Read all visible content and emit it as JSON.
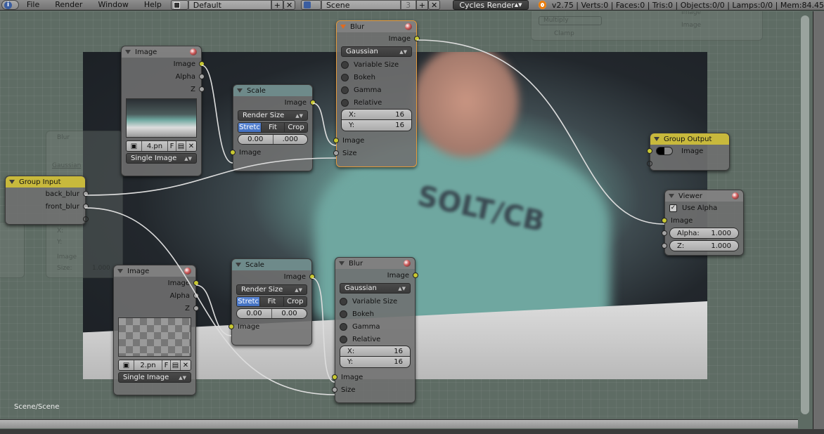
{
  "topbar": {
    "info_icon": "info-icon",
    "menus": [
      "File",
      "Render",
      "Window",
      "Help"
    ],
    "layout_name": "Default",
    "scene_name": "Scene",
    "scene_users": "3",
    "engine": "Cycles Render",
    "stats": "v2.75 | Verts:0 | Faces:0 | Tris:0 | Objects:0/0 | Lamps:0/0 | Mem:84.45"
  },
  "ghost": {
    "multiply": "Multiply",
    "clamp": "Clamp",
    "image1": "Image",
    "image2": "Image",
    "blur": "Blur",
    "gaussian": "Gaussian",
    "x": "X:",
    "y": "Y:",
    "image": "Image",
    "size": "Size:",
    "size_val": "1.000"
  },
  "nodes": {
    "image_top": {
      "title": "Image",
      "outputs": [
        "Image",
        "Alpha",
        "Z"
      ],
      "file": "4.pn",
      "fake_user": "F",
      "source": "Single Image"
    },
    "scale_top": {
      "title": "Scale",
      "output": "Image",
      "space": "Render Size",
      "modes": [
        "Stretc",
        "Fit",
        "Crop"
      ],
      "active_mode": "Stretc",
      "offset_x": "0.00",
      "offset_y": ".000",
      "input": "Image"
    },
    "blur_top": {
      "title": "Blur",
      "output": "Image",
      "filter": "Gaussian",
      "options": [
        "Variable Size",
        "Bokeh",
        "Gamma",
        "Relative"
      ],
      "x_label": "X:",
      "x_val": "16",
      "y_label": "Y:",
      "y_val": "16",
      "inputs": [
        "Image",
        "Size"
      ]
    },
    "group_input": {
      "title": "Group Input",
      "outputs": [
        "back_blur",
        "front_blur"
      ]
    },
    "group_output": {
      "title": "Group Output",
      "input": "Image"
    },
    "viewer": {
      "title": "Viewer",
      "use_alpha": "Use Alpha",
      "use_alpha_checked": true,
      "input": "Image",
      "alpha_label": "Alpha:",
      "alpha_val": "1.000",
      "z_label": "Z:",
      "z_val": "1.000"
    },
    "image_bottom": {
      "title": "Image",
      "outputs": [
        "Image",
        "Alpha",
        "Z"
      ],
      "file": "2.pn",
      "fake_user": "F",
      "source": "Single Image"
    },
    "scale_bottom": {
      "title": "Scale",
      "output": "Image",
      "space": "Render Size",
      "modes": [
        "Stretc",
        "Fit",
        "Crop"
      ],
      "active_mode": "Stretc",
      "offset_x": "0.00",
      "offset_y": "0.00",
      "input": "Image"
    },
    "blur_bottom": {
      "title": "Blur",
      "output": "Image",
      "filter": "Gaussian",
      "options": [
        "Variable Size",
        "Bokeh",
        "Gamma",
        "Relative"
      ],
      "x_label": "X:",
      "x_val": "16",
      "y_label": "Y:",
      "y_val": "16",
      "inputs": [
        "Image",
        "Size"
      ]
    }
  },
  "backdrop_print": "SOLT/CB",
  "footer": {
    "scene_label": "Scene/Scene"
  },
  "colors": {
    "socket_image": "#c8c832",
    "socket_value": "#a3a3a3",
    "group_header": "#c8b93c",
    "active_border": "#e49a3c",
    "toggle_on": "#4a78c8"
  }
}
